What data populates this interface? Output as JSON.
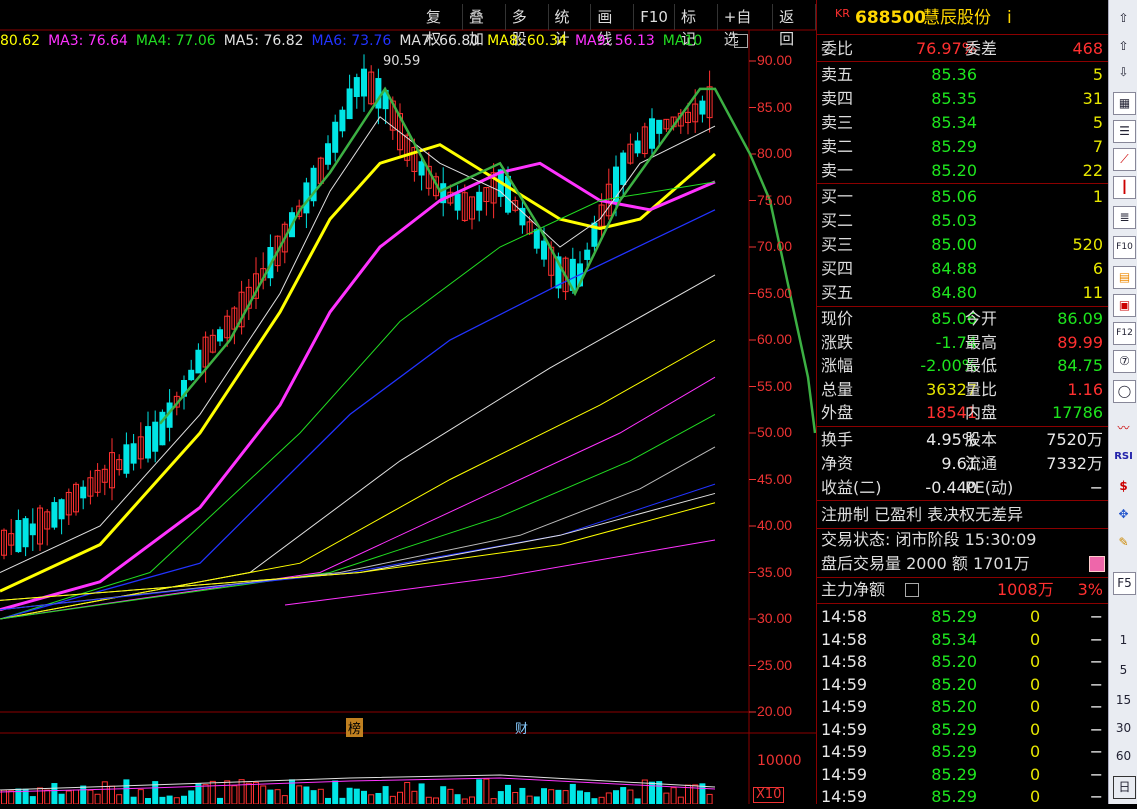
{
  "toolbar": [
    "复权",
    "叠加",
    "多股",
    "统计",
    "画线",
    "F10",
    "标记",
    "+自选",
    "返回"
  ],
  "ma_legend": [
    {
      "label": "80.62",
      "color": "#ffff00"
    },
    {
      "label": "MA3: 76.64",
      "color": "#ff33ff"
    },
    {
      "label": "MA4: 77.06",
      "color": "#22dd22"
    },
    {
      "label": "MA5: 76.82",
      "color": "#e0e0e0"
    },
    {
      "label": "MA6: 73.76",
      "color": "#2233ff"
    },
    {
      "label": "MA7: 66.80",
      "color": "#e0e0e0"
    },
    {
      "label": "MA8: 60.34",
      "color": "#ffff00"
    },
    {
      "label": "MA9: 56.13",
      "color": "#ff33ff"
    },
    {
      "label": "MA10",
      "color": "#22dd22"
    }
  ],
  "peak_label": "90.59",
  "y_ticks": [
    "90.00",
    "85.00",
    "80.00",
    "75.00",
    "70.00",
    "65.00",
    "60.00",
    "55.00",
    "50.00",
    "45.00",
    "40.00",
    "35.00",
    "30.00",
    "25.00",
    "20.00"
  ],
  "vol_tick": "10000",
  "vol_unit": "X10",
  "markers": {
    "bang": "榜",
    "cai": "财"
  },
  "stock": {
    "prefix": "KR",
    "code": "688500",
    "name": "慧辰股份",
    "info": "i"
  },
  "weibi": {
    "label": "委比",
    "value": "76.97%",
    "label2": "委差",
    "value2": "468"
  },
  "asks": [
    {
      "label": "卖五",
      "price": "85.36",
      "vol": "5"
    },
    {
      "label": "卖四",
      "price": "85.35",
      "vol": "31"
    },
    {
      "label": "卖三",
      "price": "85.34",
      "vol": "5"
    },
    {
      "label": "卖二",
      "price": "85.29",
      "vol": "7"
    },
    {
      "label": "卖一",
      "price": "85.20",
      "vol": "22"
    }
  ],
  "bids": [
    {
      "label": "买一",
      "price": "85.06",
      "vol": "1"
    },
    {
      "label": "买二",
      "price": "85.03",
      "vol": ""
    },
    {
      "label": "买三",
      "price": "85.00",
      "vol": "520"
    },
    {
      "label": "买四",
      "price": "84.88",
      "vol": "6"
    },
    {
      "label": "买五",
      "price": "84.80",
      "vol": "11"
    }
  ],
  "quote": [
    {
      "l1": "现价",
      "v1": "85.06",
      "c1": "g",
      "l2": "今开",
      "v2": "86.09",
      "c2": "g"
    },
    {
      "l1": "涨跌",
      "v1": "-1.74",
      "c1": "g",
      "l2": "最高",
      "v2": "89.99",
      "c2": "r"
    },
    {
      "l1": "涨幅",
      "v1": "-2.00%",
      "c1": "g",
      "l2": "最低",
      "v2": "84.75",
      "c2": "g"
    },
    {
      "l1": "总量",
      "v1": "36327",
      "c1": "y",
      "l2": "量比",
      "v2": "1.16",
      "c2": "r"
    },
    {
      "l1": "外盘",
      "v1": "18541",
      "c1": "r",
      "l2": "内盘",
      "v2": "17786",
      "c2": "g"
    }
  ],
  "stats": [
    {
      "l1": "换手",
      "v1": "4.95%",
      "l2": "股本",
      "v2": "7520万"
    },
    {
      "l1": "净资",
      "v1": "9.61",
      "l2": "流通",
      "v2": "7332万"
    },
    {
      "l1": "收益(二)",
      "v1": "-0.440",
      "l2": "PE(动)",
      "v2": "−"
    }
  ],
  "tags": "注册制 已盈利 表决权无差异",
  "trade_status": "交易状态: 闭市阶段 15:30:09",
  "after_hours": "盘后交易量 2000 额 1701万",
  "main_flow": {
    "label": "主力净额",
    "value": "1008万",
    "pct": "3%"
  },
  "ticks": [
    {
      "time": "14:58",
      "price": "85.29",
      "vol": "0",
      "flag": "−"
    },
    {
      "time": "14:58",
      "price": "85.34",
      "vol": "0",
      "flag": "−"
    },
    {
      "time": "14:58",
      "price": "85.20",
      "vol": "0",
      "flag": "−"
    },
    {
      "time": "14:59",
      "price": "85.20",
      "vol": "0",
      "flag": "−"
    },
    {
      "time": "14:59",
      "price": "85.20",
      "vol": "0",
      "flag": "−"
    },
    {
      "time": "14:59",
      "price": "85.29",
      "vol": "0",
      "flag": "−"
    },
    {
      "time": "14:59",
      "price": "85.29",
      "vol": "0",
      "flag": "−"
    },
    {
      "time": "14:59",
      "price": "85.29",
      "vol": "0",
      "flag": "−"
    },
    {
      "time": "14:59",
      "price": "85.29",
      "vol": "0",
      "flag": "−"
    }
  ],
  "sidebar_labels": [
    "F5",
    "1",
    "5",
    "15",
    "30",
    "60",
    "日"
  ],
  "colors": {
    "up": "#ff3030",
    "down": "#00e5e5",
    "panel_border": "#8b0000"
  }
}
